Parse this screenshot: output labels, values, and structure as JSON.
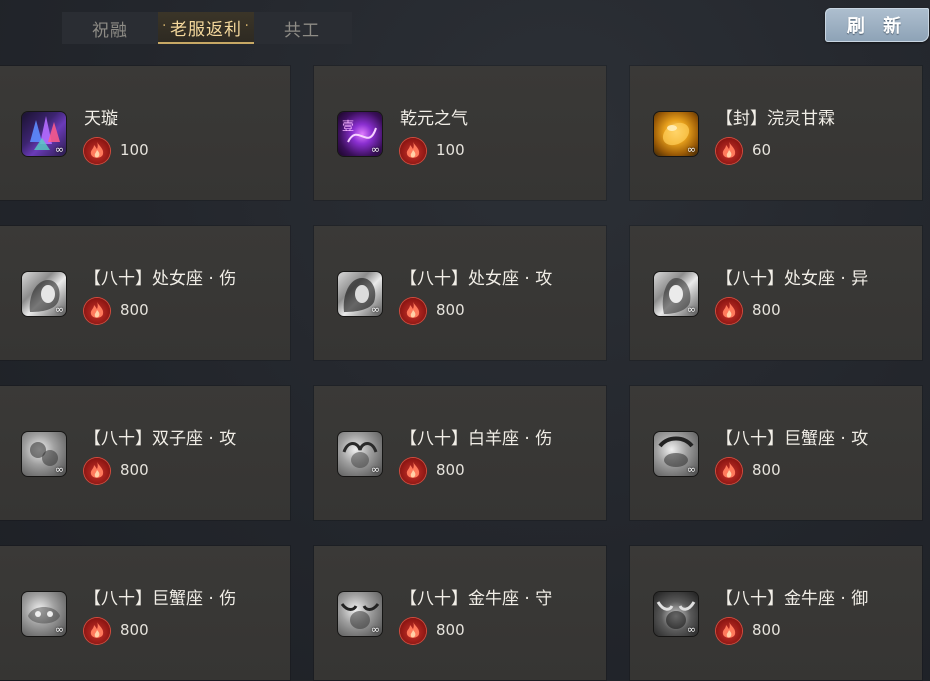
{
  "tabs": [
    {
      "label": "祝融",
      "active": false
    },
    {
      "label": "老服返利",
      "active": true
    },
    {
      "label": "共工",
      "active": false
    }
  ],
  "refresh_label": "刷 新",
  "currency_icon": "red-flame-icon",
  "infinity_mark": "∞",
  "items": [
    {
      "name": "天璇",
      "cost": "100",
      "icon": "crystal-icon"
    },
    {
      "name": "乾元之气",
      "cost": "100",
      "icon": "purple-orb-icon"
    },
    {
      "name": "【封】浣灵甘霖",
      "cost": "60",
      "icon": "amber-gem-icon"
    },
    {
      "name": "【八十】处女座 · 伤",
      "cost": "800",
      "icon": "virgo-portrait-icon"
    },
    {
      "name": "【八十】处女座 · 攻",
      "cost": "800",
      "icon": "virgo-portrait-icon"
    },
    {
      "name": "【八十】处女座 · 异",
      "cost": "800",
      "icon": "virgo-portrait-icon"
    },
    {
      "name": "【八十】双子座 · 攻",
      "cost": "800",
      "icon": "gemini-portrait-icon"
    },
    {
      "name": "【八十】白羊座 · 伤",
      "cost": "800",
      "icon": "aries-portrait-icon"
    },
    {
      "name": "【八十】巨蟹座 · 攻",
      "cost": "800",
      "icon": "cancer-portrait-icon"
    },
    {
      "name": "【八十】巨蟹座 · 伤",
      "cost": "800",
      "icon": "cancer-portrait-icon"
    },
    {
      "name": "【八十】金牛座 · 守",
      "cost": "800",
      "icon": "taurus-portrait-icon"
    },
    {
      "name": "【八十】金牛座 · 御",
      "cost": "800",
      "icon": "taurus-portrait-icon"
    }
  ]
}
